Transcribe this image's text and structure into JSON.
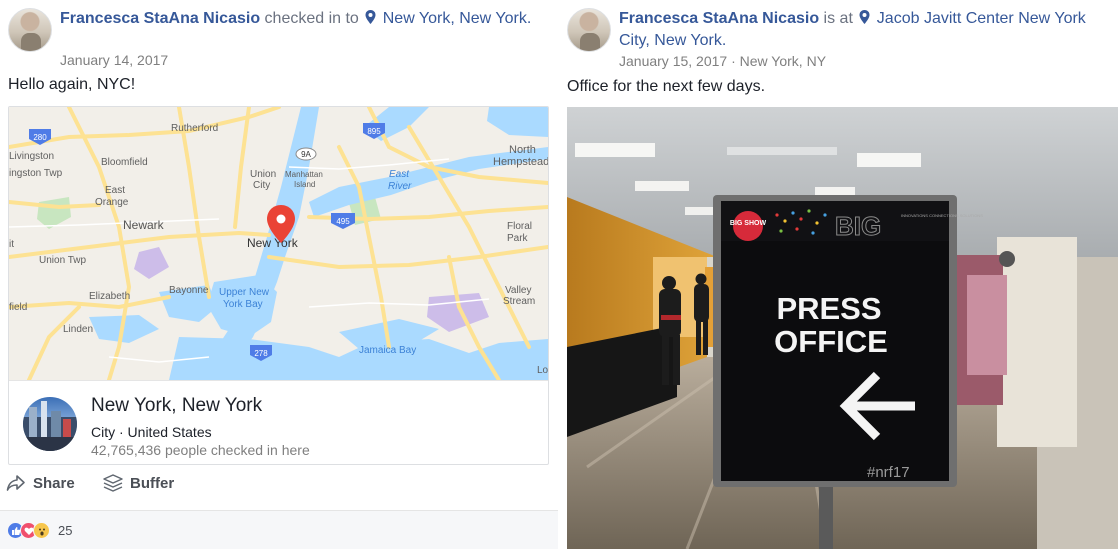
{
  "posts": [
    {
      "author": "Francesca StaAna Nicasio",
      "action": "checked in to",
      "place": "New York, New York.",
      "date": "January 14, 2017",
      "text": "Hello again, NYC!",
      "map_labels": {
        "rutherford": "Rutherford",
        "livingston": "Livingston",
        "livingston_twp": "ingston Twp",
        "bloomfield": "Bloomfield",
        "east_orange": "East Orange",
        "union_city": "Union City",
        "manhattan": "Manhattan Island",
        "east_river": "East River",
        "north_hempstead": "North Hempstead",
        "newark": "Newark",
        "new_york": "New York",
        "floral_park": "Floral Park",
        "union_twp": "Union Twp",
        "elizabeth": "Elizabeth",
        "bayonne": "Bayonne",
        "upper_ny_bay": "Upper New York Bay",
        "valley_stream": "Valley Stream",
        "field": "field",
        "linden": "Linden",
        "jamaica_bay": "Jamaica Bay",
        "shield_280": "280",
        "shield_895": "895",
        "shield_9a": "9A",
        "shield_495": "495",
        "shield_278": "278",
        "it": "it",
        "lo": "Lo"
      },
      "place_card": {
        "title": "New York, New York",
        "subtitle": "City · United States",
        "count": "42,765,436 people checked in here"
      },
      "actions": {
        "share": "Share",
        "buffer": "Buffer"
      },
      "reactions": {
        "count": "25"
      }
    },
    {
      "author": "Francesca StaAna Nicasio",
      "action": "is at",
      "place": "Jacob Javitt Center New York City, New York.",
      "date": "January 15, 2017",
      "location_suffix": "New York, NY",
      "text": "Office for the next few days.",
      "photo": {
        "sign_line1": "PRESS",
        "sign_line2": "OFFICE",
        "hashtag": "#nrf17",
        "logo_text": "BIG",
        "logo_badge": "BIG SHOW",
        "tagline": "INNOVATIONS CONNECTIONS SOLUTIONS"
      }
    }
  ],
  "colors": {
    "link": "#365899",
    "map_water": "#aadaff",
    "map_land": "#f2efe9",
    "map_road": "#fde293",
    "pin": "#ea4335",
    "like": "#4f7ce7",
    "love": "#f0506e",
    "wow": "#f7c64c"
  },
  "icons": [
    "pin-icon",
    "share-icon",
    "buffer-icon",
    "like-reaction-icon",
    "love-reaction-icon",
    "wow-reaction-icon",
    "map-pin-icon",
    "arrow-left-icon"
  ]
}
